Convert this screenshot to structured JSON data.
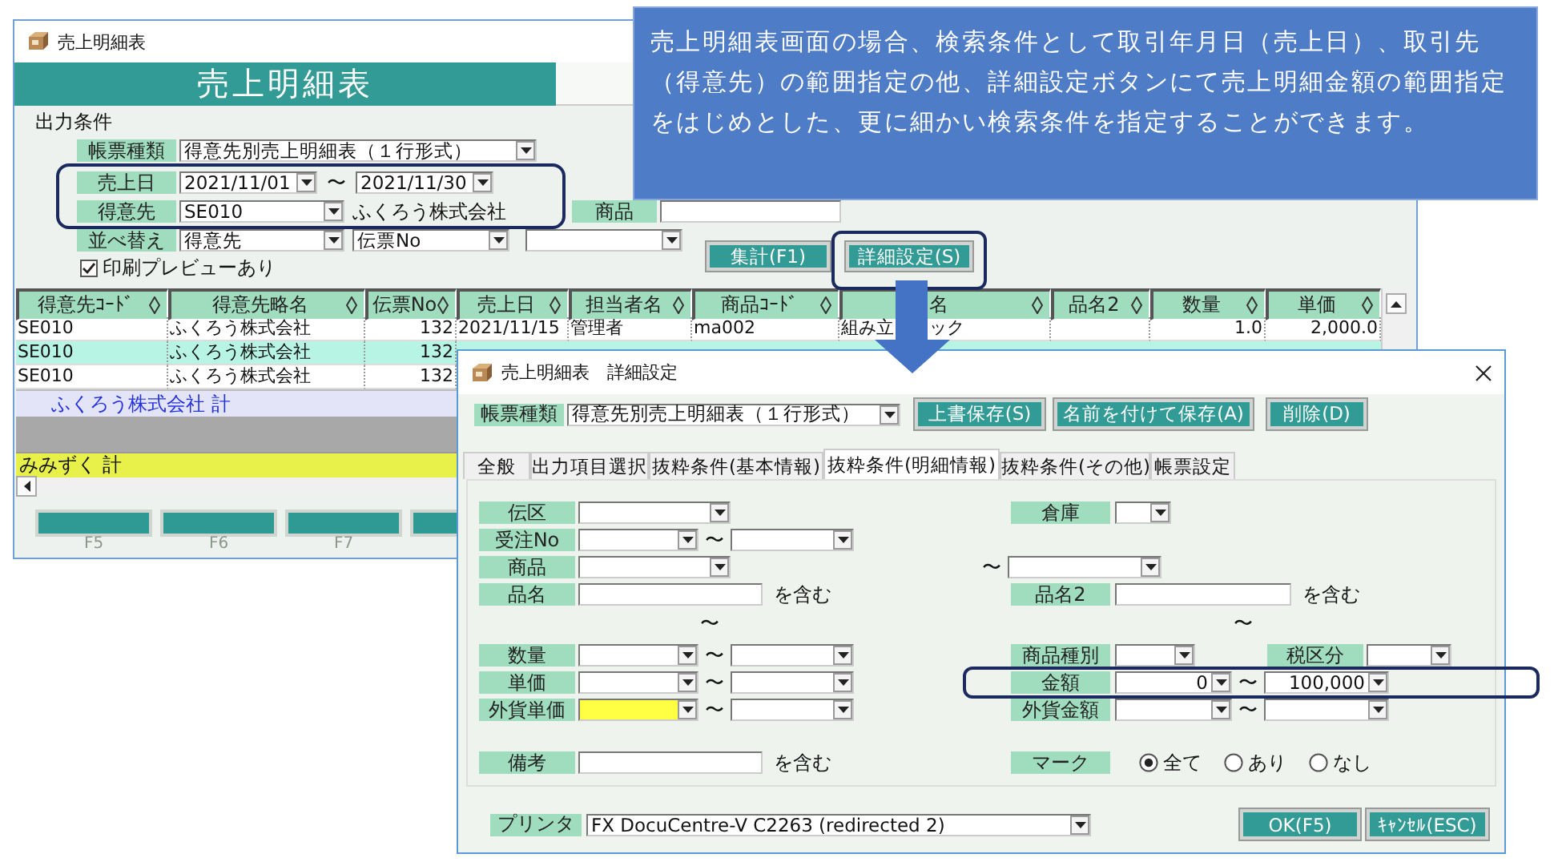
{
  "back_window": {
    "title": "売上明細表",
    "banner": "売上明細表",
    "section": "出力条件",
    "report_type": {
      "label": "帳票種類",
      "value": "得意先別売上明細表（１行形式）"
    },
    "filters_highlighted": true,
    "sales_date": {
      "label": "売上日",
      "from": "2021/11/01",
      "separator": "〜",
      "to": "2021/11/30"
    },
    "customer": {
      "label": "得意先",
      "code": "SE010",
      "name": "ふくろう株式会社"
    },
    "product_label": "商品",
    "sort": {
      "label": "並べ替え",
      "keys": [
        "得意先",
        "伝票No"
      ]
    },
    "preview": {
      "label": "印刷プレビューあり",
      "checked": true
    },
    "buttons": [
      {
        "label": "集計(F1)",
        "highlighted": false
      },
      {
        "label": "詳細設定(S)",
        "highlighted": true
      }
    ],
    "table": {
      "columns": [
        "得意先ｺｰﾄﾞ",
        "得意先略名",
        "伝票No",
        "売上日",
        "担当者名",
        "商品ｺｰﾄﾞ",
        "名",
        "品名2",
        "数量",
        "単価"
      ],
      "rows": [
        {
          "selected": false,
          "cells": [
            "SE010",
            "ふくろう株式会社",
            "132",
            "2021/11/15",
            "管理者",
            "ma002",
            [
              "組み立",
              "ック"
            ],
            null,
            "1.0",
            "2,000.0"
          ]
        },
        {
          "selected": true,
          "cells": [
            "SE010",
            "ふくろう株式会社",
            "132"
          ]
        },
        {
          "selected": false,
          "cells": [
            "SE010",
            "ふくろう株式会社",
            "132"
          ]
        }
      ]
    },
    "subtotal": "ふくろう株式会社 計",
    "grand_total": "みみずく 計",
    "function_keys": [
      "F5",
      "F6",
      "F7"
    ]
  },
  "callout": {
    "text": "売上明細表画面の場合、検索条件として取引年月日（売上日）、取引先（得意先）の範囲指定の他、詳細設定ボタンにて売上明細金額の範囲指定をはじめとした、更に細かい検索条件を指定することができます。"
  },
  "dialog": {
    "title": "売上明細表　詳細設定",
    "report_type": {
      "label": "帳票種類",
      "value": "得意先別売上明細表（１行形式）"
    },
    "buttons": [
      "上書保存(S)",
      "名前を付けて保存(A)",
      "削除(D)"
    ],
    "tabs": [
      {
        "label": "全般",
        "selected": false
      },
      {
        "label": "出力項目選択",
        "selected": false
      },
      {
        "label": "抜粋条件(基本情報)",
        "selected": false
      },
      {
        "label": "抜粋条件(明細情報)",
        "selected": true
      },
      {
        "label": "抜粋条件(その他)",
        "selected": false
      },
      {
        "label": "帳票設定",
        "selected": false
      }
    ],
    "rows": [
      {
        "left": {
          "kind": "select",
          "label": "伝区"
        },
        "right": {
          "kind": "select_small",
          "label": "倉庫"
        }
      },
      {
        "left": {
          "kind": "range",
          "label": "受注No",
          "separator": "〜",
          "focused": false
        }
      },
      {
        "left": {
          "kind": "select",
          "label": "商品"
        },
        "right": {
          "kind": "tilde_select",
          "separator": "〜"
        }
      },
      {
        "left": {
          "kind": "contains",
          "label": "品名",
          "suffix": "を含む"
        },
        "right": {
          "kind": "contains",
          "label": "品名2",
          "suffix": "を含む"
        }
      },
      {
        "left": {
          "kind": "tilde",
          "separator": "〜"
        },
        "right": {
          "kind": "tilde",
          "separator": "〜"
        }
      },
      {
        "left": {
          "kind": "range",
          "label": "数量",
          "separator": "〜",
          "focused": false
        },
        "right": {
          "kind": "double_select",
          "label": "商品種別",
          "label2": "税区分"
        }
      },
      {
        "left": {
          "kind": "range",
          "label": "単価",
          "separator": "〜",
          "focused": false
        },
        "right": {
          "kind": "range",
          "label": "金額",
          "separator": "〜",
          "from": "0",
          "to": "100,000",
          "focused": false,
          "highlighted": true
        }
      },
      {
        "left": {
          "kind": "range",
          "label": "外貨単価",
          "separator": "〜",
          "focused": true
        },
        "right": {
          "kind": "range",
          "label": "外貨金額",
          "separator": "〜",
          "focused": false,
          "highlighted": false
        }
      },
      {
        "left": {
          "kind": "contains",
          "label": "備考",
          "suffix": "を含む"
        },
        "right": {
          "kind": "radio",
          "label": "マーク",
          "options": [
            {
              "label": "全て",
              "selected": true
            },
            {
              "label": "あり",
              "selected": false
            },
            {
              "label": "なし",
              "selected": false
            }
          ]
        }
      }
    ],
    "printer": {
      "label": "プリンタ",
      "value": "FX DocuCentre-V C2263 (redirected 2)"
    },
    "actions": [
      "OK(F5)",
      "ｷｬﾝｾﾙ(ESC)"
    ]
  }
}
